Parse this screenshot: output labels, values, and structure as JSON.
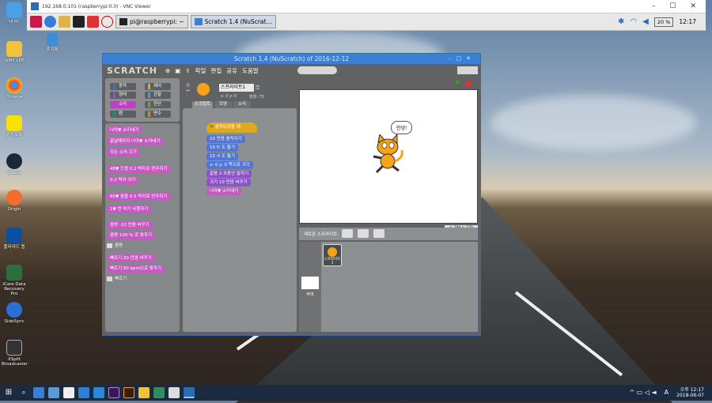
{
  "vnc": {
    "title": "192.168.0.101 (raspberrypi:0.0) - VNC Viewer",
    "minimize": "–",
    "maximize": "☐",
    "close": "✕"
  },
  "pi_taskbar": {
    "terminal_task": "pi@raspberrypi: ~",
    "scratch_task": "Scratch 1.4 (NuScrat...",
    "battery": "20 %",
    "clock": "12:17"
  },
  "desktop": {
    "icons": [
      "내 PC",
      "SIMP LEE",
      "Chrome",
      "카카오톡",
      "Steam",
      "Origin",
      "플러자드 랩",
      "iCare Data Recovery Pro",
      "SideSync",
      "XSplit Broadcaster"
    ],
    "recycle": "휴지통"
  },
  "scratch": {
    "title": "Scratch 1.4 (NuScratch) of 2016-12-12",
    "logo": "SCRATCH",
    "menu": [
      "파일",
      "편집",
      "공유",
      "도움말"
    ],
    "categories": [
      {
        "label": "동작",
        "color": "#4a6cd4"
      },
      {
        "label": "제어",
        "color": "#e6a822"
      },
      {
        "label": "형태",
        "color": "#8a55d7"
      },
      {
        "label": "관찰",
        "color": "#2ca5e2"
      },
      {
        "label": "소리",
        "color": "#bb42c3"
      },
      {
        "label": "연산",
        "color": "#5cb712"
      },
      {
        "label": "펜",
        "color": "#0e9a6c"
      },
      {
        "label": "변수",
        "color": "#ee7d16"
      }
    ],
    "palette_blocks": [
      "나야▼ 소리내기",
      "끝날때까지 나야▼ 소리내기",
      "모든 소리 끄기",
      "48▼ 드럼 0.2 박자로 연주하기",
      "0.2 박자 쉬기",
      "60▼ 음을 0.5 박자로 연주하기",
      "1▼ 번 악기 사용하기",
      "음량 -10 만큼 바꾸기",
      "음량 100 % 로 맞추기",
      "음량",
      "빠르기 20 만큼 바꾸기",
      "빠르기 60 bpm으로 맞추기",
      "빠르기"
    ],
    "sprite_name": "스프라이트1",
    "sprite_xy": "x: 0  y: 0",
    "sprite_dir": "방향: 75",
    "tabs": [
      "스크립트",
      "모양",
      "소리"
    ],
    "script_blocks": [
      "클릭되었을 때",
      "10 만큼 움직이기",
      "15 ↻ 도 돌기",
      "15 ↺ 도 돌기",
      "x: 0  y: 0 쪽으로 가기",
      "같음 2 초동안 말하기",
      "크기 10 만큼 바꾸기",
      "나야▼ 소리내기"
    ],
    "speech": "안녕!",
    "mouse_xy": "x: 184  y: 150",
    "new_sprite_label": "새로운 스프라이트:",
    "sprite_thumb_label": "스프라이트1",
    "stage_label": "무대"
  },
  "windows_taskbar": {
    "time": "오후 12:17",
    "date": "2018-06-07",
    "lang": "A"
  }
}
